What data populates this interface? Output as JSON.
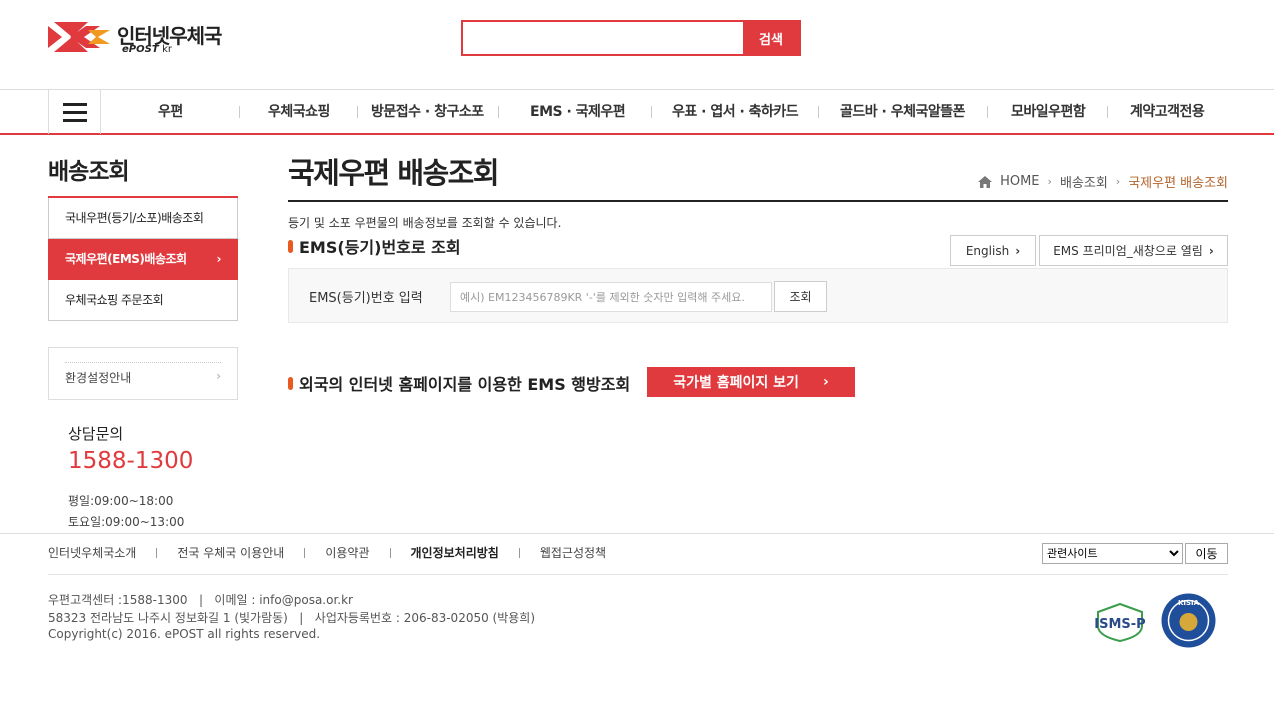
{
  "header": {
    "logo_title": "인터넷우체국",
    "logo_sub_bold": "ePOST",
    "logo_sub_plain": "kr",
    "search": {
      "value": "",
      "placeholder": "",
      "button_label": "검색"
    }
  },
  "gnb": {
    "items": [
      "우편",
      "우체국쇼핑",
      "방문접수 · 창구소포",
      "EMS · 국제우편",
      "우표 · 엽서 · 축하카드",
      "골드바 · 우체국알뜰폰",
      "모바일우편함",
      "계약고객전용"
    ]
  },
  "sidebar": {
    "title": "배송조회",
    "items": [
      {
        "label": "국내우편(등기/소포)배송조회"
      },
      {
        "label": "국제우편(EMS)배송조회"
      },
      {
        "label": "우체국쇼핑 주문조회"
      }
    ],
    "env_label": "환경설정안내",
    "counsel": {
      "title": "상담문의",
      "phone": "1588-1300",
      "weekday_hours": "평일:09:00~18:00",
      "saturday_hours": "토요일:09:00~13:00"
    }
  },
  "main": {
    "title": "국제우편 배송조회",
    "breadcrumb": [
      "HOME",
      "배송조회",
      "국제우편 배송조회"
    ],
    "description": "등기 및 소포 우편물의 배송정보를 조회할 수 있습니다.",
    "section1_title": "EMS(등기)번호로 조회",
    "english_button": "English",
    "premium_button": "EMS 프리미엄_새창으로 열림",
    "form": {
      "label": "EMS(등기)번호 입력",
      "placeholder": "예시) EM123456789KR '-'를 제외한 숫자만 입력해 주세요.",
      "value": "",
      "button_label": "조회"
    },
    "section2_title": "외국의 인터넷 홈페이지를 이용한 EMS 행방조회",
    "country_button": "국가별 홈페이지 보기"
  },
  "footer": {
    "links": [
      "인터넷우체국소개",
      "전국 우체국 이용안내",
      "이용약관",
      "개인정보처리방침",
      "웹접근성정책"
    ],
    "related_select": "관련사이트",
    "go_button": "이동",
    "info_line1": "우편고객센터 :1588-1300   |   이메일 : info@posa.or.kr",
    "info_line2": "58323 전라남도 나주시 정보화길 1 (빛가람동)   |   사업자등록번호 : 206-83-02050 (박용희)",
    "copyright": "Copyright(c) 2016. ePOST all rights reserved.",
    "isms_label": "ISMS-P",
    "kisia_label": "KISIA"
  },
  "colors": {
    "accent": "#e03a3e",
    "breadcrumb_current": "#b4652e",
    "bullet": "#e85a20"
  }
}
